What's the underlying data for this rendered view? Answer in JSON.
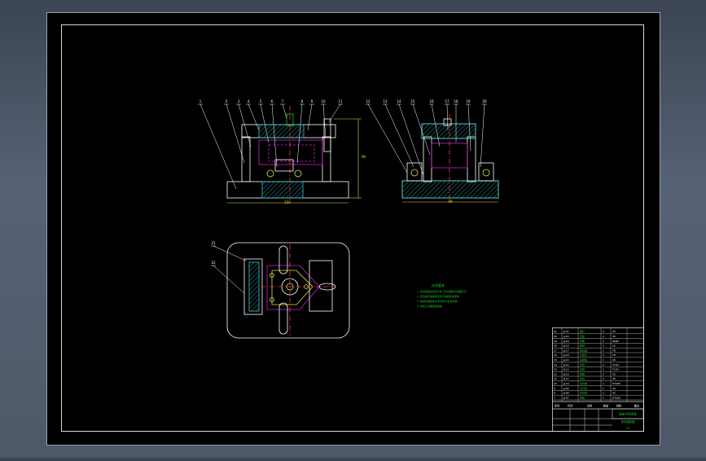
{
  "drawing": {
    "background": "#000000",
    "line_color": "#ffffff",
    "hatch_color": "#35c8c8",
    "part_color": "#d020d0",
    "highlight_color": "#20d020",
    "accent_color": "#e0e040",
    "frame_color": "#d8d8d8"
  },
  "front_view": {
    "balloons": [
      "1",
      "2",
      "3",
      "4",
      "5",
      "6",
      "7",
      "8",
      "9",
      "10",
      "11"
    ],
    "dim_width": "150",
    "dim_height": "90"
  },
  "side_view": {
    "balloons": [
      "12",
      "13",
      "14",
      "15",
      "16",
      "17",
      "18",
      "19",
      "20"
    ],
    "dim_width": "90"
  },
  "top_view": {
    "balloons": [
      "21",
      "22"
    ]
  },
  "technical_requirements": {
    "title": "技术要求",
    "lines": [
      "1. 夹具装配后定位元件工作表面须与底面平行",
      "2. 定位销与底板配合处不得有松动现象",
      "3. 各零件装配前必须清洗干净,去毛刺",
      "4. 非加工表面涂防锈漆"
    ]
  },
  "title_block": {
    "drawing_name": "铣床专用夹具",
    "drawing_subtitle": "夹具装配图",
    "sheet": "01",
    "header_cells": [
      "序号",
      "代号",
      "名称",
      "数量",
      "材料",
      "备注"
    ],
    "parts_rows": [
      [
        "21",
        "JJ-21",
        "螺钉",
        "4",
        "35"
      ],
      [
        "20",
        "JJ-20",
        "压板",
        "2",
        "45"
      ],
      [
        "19",
        "JJ-19",
        "弹簧",
        "2",
        "65Mn"
      ],
      [
        "18",
        "JJ-18",
        "螺母",
        "2",
        "35"
      ],
      [
        "17",
        "JJ-17",
        "定位销",
        "1",
        "T8"
      ],
      [
        "16",
        "JJ-16",
        "支承钉",
        "3",
        "T8"
      ],
      [
        "15",
        "JJ-15",
        "钻模板",
        "1",
        "45"
      ],
      [
        "14",
        "JJ-14",
        "衬套",
        "2",
        "T10A"
      ],
      [
        "13",
        "JJ-13",
        "钻套",
        "2",
        "T10A"
      ],
      [
        "12",
        "JJ-12",
        "垫圈",
        "2",
        "35"
      ],
      [
        "11",
        "JJ-11",
        "支柱",
        "2",
        "45"
      ],
      [
        "10",
        "JJ-10",
        "夹具体",
        "1",
        "HT200"
      ],
      [
        "9",
        "JJ-09",
        "对刀块",
        "1",
        "20"
      ],
      [
        "8",
        "JJ-08",
        "定位键",
        "2",
        "45"
      ],
      [
        "7",
        "JJ-07",
        "底板",
        "1",
        "HT200"
      ]
    ]
  }
}
